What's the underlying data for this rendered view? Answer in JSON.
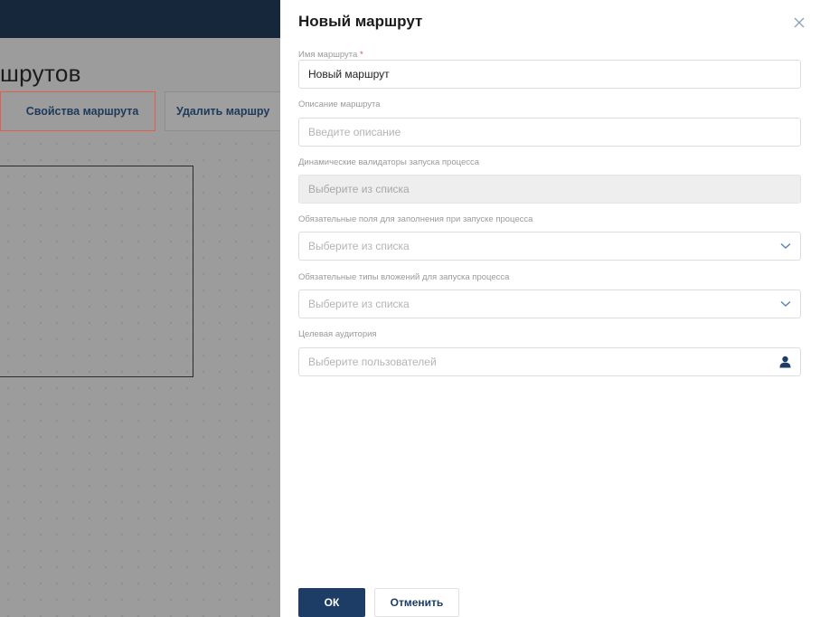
{
  "background": {
    "title": "шрутов",
    "properties_button": "Свойства маршрута",
    "delete_button": "Удалить маршру"
  },
  "panel": {
    "title": "Новый маршрут",
    "fields": {
      "name": {
        "label": "Имя маршрута",
        "required_mark": "*",
        "value": "Новый маршрут"
      },
      "description": {
        "label": "Описание маршрута",
        "placeholder": "Введите описание"
      },
      "validators": {
        "label": "Динамические валидаторы запуска процесса",
        "placeholder": "Выберите из списка"
      },
      "required_fields": {
        "label": "Обязательные поля для заполнения при запуске процесса",
        "placeholder": "Выберите из списка"
      },
      "attachment_types": {
        "label": "Обязательные типы вложений для запуска процесса",
        "placeholder": "Выберите из списка"
      },
      "audience": {
        "label": "Целевая аудитория",
        "placeholder": "Выберите пользователей"
      }
    },
    "ok_button": "ОК",
    "cancel_button": "Отменить"
  },
  "colors": {
    "header": "#16273b",
    "primary": "#1d3d66",
    "highlight": "#e0604a"
  },
  "icons": {
    "close": "close-icon",
    "dropdown": "chevron-down-icon",
    "user": "user-icon"
  }
}
